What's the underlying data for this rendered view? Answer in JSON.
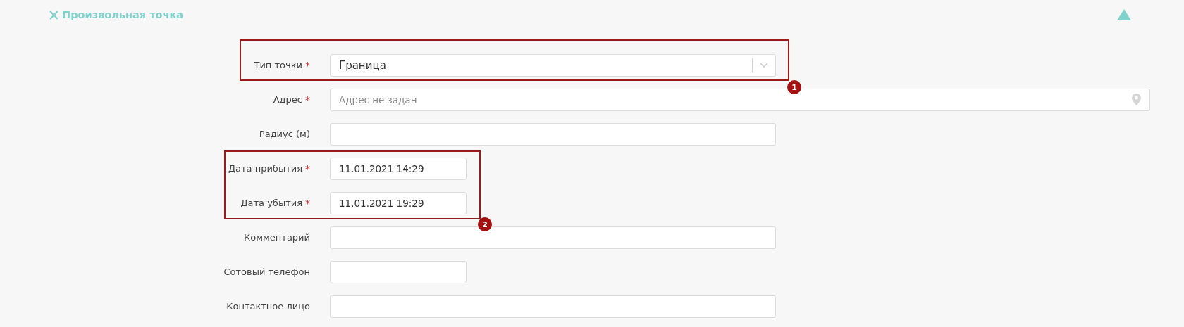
{
  "section": {
    "title": "Произвольная точка",
    "expanded": true
  },
  "required_mark": "*",
  "fields": [
    {
      "label": "Тип точки",
      "required": true,
      "kind": "select",
      "value": "Граница"
    },
    {
      "label": "Адрес",
      "required": true,
      "kind": "location",
      "placeholder": "Адрес не задан"
    },
    {
      "label": "Радиус (м)",
      "required": false,
      "kind": "text"
    },
    {
      "label": "Дата прибытия",
      "required": true,
      "kind": "text",
      "value": "11.01.2021 14:29"
    },
    {
      "label": "Дата убытия",
      "required": true,
      "kind": "text",
      "value": "11.01.2021 19:29"
    },
    {
      "label": "Комментарий",
      "required": false,
      "kind": "text"
    },
    {
      "label": "Сотовый телефон",
      "required": false,
      "kind": "text"
    },
    {
      "label": "Контактное лицо",
      "required": false,
      "kind": "text"
    }
  ],
  "annotations": [
    {
      "number": "1"
    },
    {
      "number": "2"
    }
  ]
}
